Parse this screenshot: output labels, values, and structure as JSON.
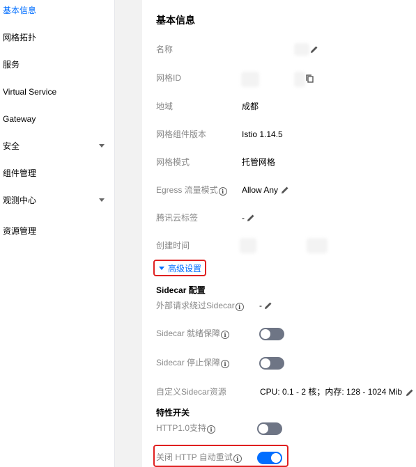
{
  "sidebar": {
    "items": [
      {
        "label": "基本信息",
        "active": true
      },
      {
        "label": "网格拓扑"
      },
      {
        "label": "服务"
      },
      {
        "label": "Virtual Service"
      },
      {
        "label": "Gateway"
      },
      {
        "label": "安全",
        "expandable": true
      },
      {
        "label": "组件管理"
      },
      {
        "label": "观测中心",
        "expandable": true
      },
      {
        "label": "资源管理"
      }
    ]
  },
  "basic": {
    "title": "基本信息",
    "name_label": "名称",
    "mesh_id_label": "网格ID",
    "region_label": "地域",
    "region_value": "成都",
    "version_label": "网格组件版本",
    "version_value": "Istio 1.14.5",
    "mode_label": "网格模式",
    "mode_value": "托管网格",
    "egress_label": "Egress 流量模式",
    "egress_value": "Allow Any",
    "tag_label": "腾讯云标签",
    "tag_value": "-",
    "created_label": "创建时间"
  },
  "advanced": {
    "toggle_label": "高级设置",
    "sidecar_heading": "Sidecar 配置",
    "bypass_label": "外部请求绕过Sidecar",
    "bypass_value": "-",
    "ready_label": "Sidecar 就绪保障",
    "ready_on": false,
    "stop_label": "Sidecar 停止保障",
    "stop_on": false,
    "resource_label": "自定义Sidecar资源",
    "resource_value": "CPU: 0.1 - 2 核；内存: 128 - 1024 Mib",
    "features_heading": "特性开关",
    "http10_label": "HTTP1.0支持",
    "http10_on": false,
    "retry_label": "关闭 HTTP 自动重试",
    "retry_on": true
  },
  "colors": {
    "accent": "#006eff",
    "highlight": "#e02020",
    "toggle_off": "#6e7585"
  }
}
